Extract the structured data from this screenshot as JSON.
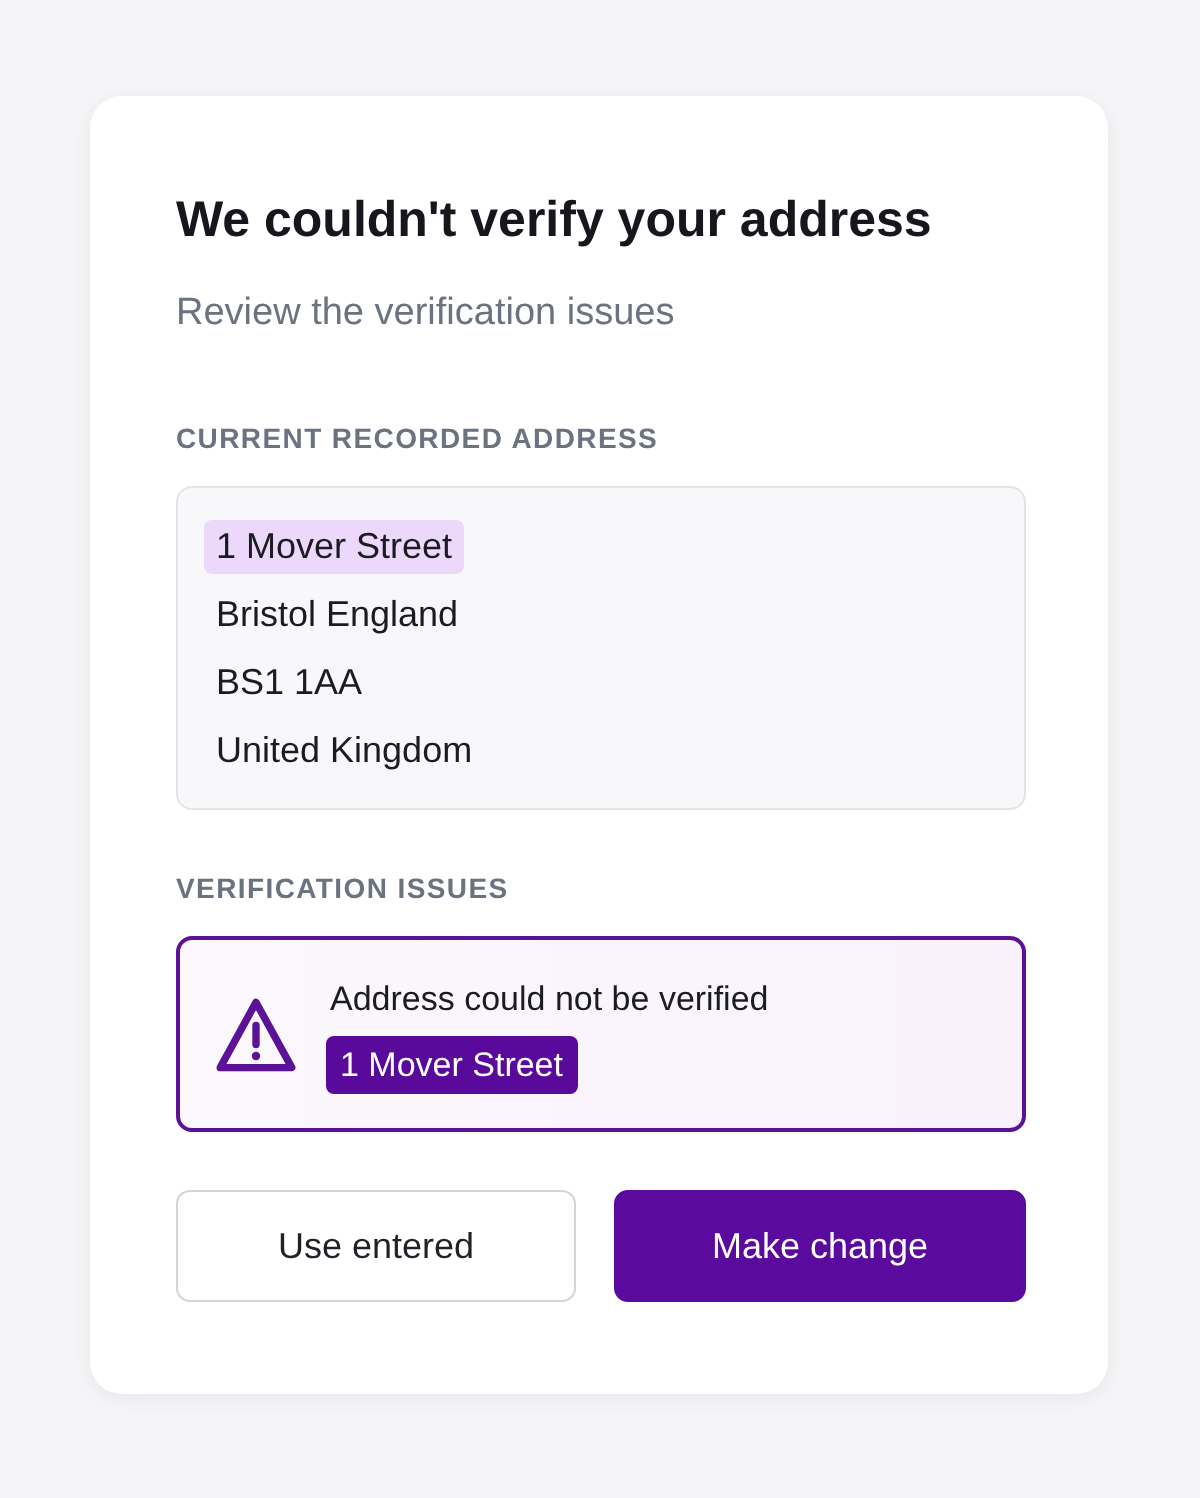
{
  "title": "We couldn't verify your address",
  "subtitle": "Review the verification issues",
  "recorded_address": {
    "label": "CURRENT RECORDED ADDRESS",
    "lines": [
      {
        "text": "1 Mover Street",
        "highlighted": true
      },
      {
        "text": "Bristol England",
        "highlighted": false
      },
      {
        "text": "BS1 1AA",
        "highlighted": false
      },
      {
        "text": "United Kingdom",
        "highlighted": false
      }
    ]
  },
  "verification_issues": {
    "label": "VERIFICATION ISSUES",
    "issues": [
      {
        "message": "Address could not be verified",
        "flagged_text": "1 Mover Street"
      }
    ]
  },
  "buttons": [
    {
      "label": "Use entered",
      "kind": "secondary"
    },
    {
      "label": "Make change",
      "kind": "primary"
    }
  ]
}
